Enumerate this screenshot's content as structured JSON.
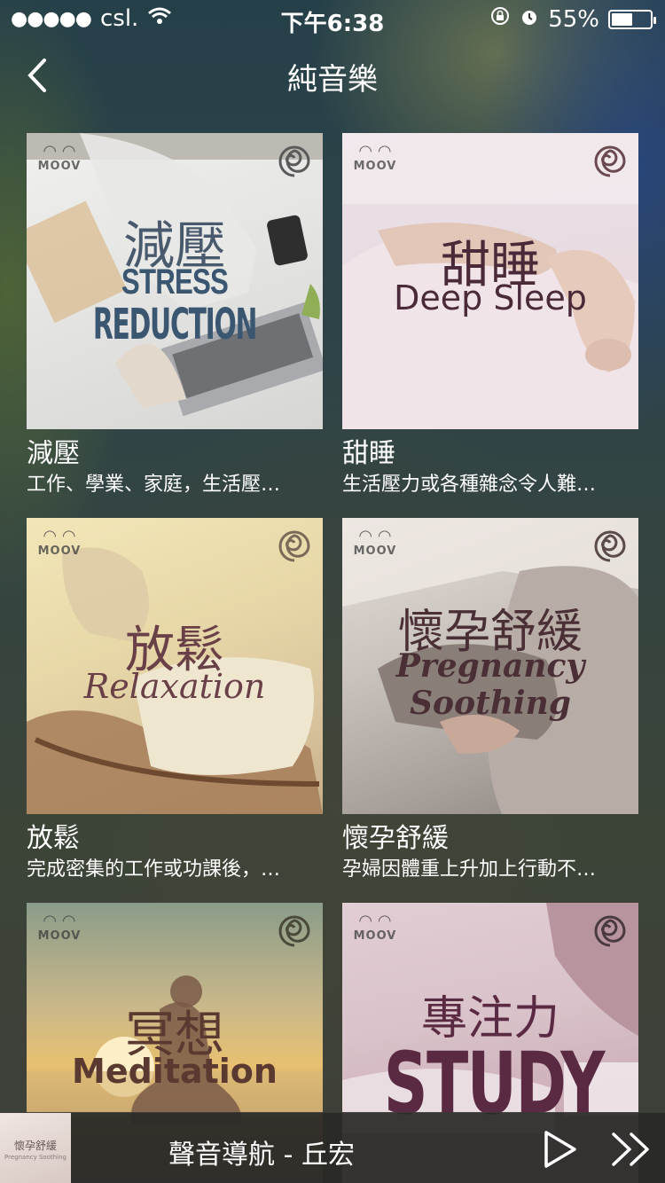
{
  "status_bar": {
    "signal_dots": "●●●●●",
    "carrier": "csl.",
    "time": "下午6:38",
    "battery_percent": "55%",
    "battery_level": 0.55,
    "icons": [
      "wifi-icon",
      "rotation-lock-icon",
      "alarm-icon",
      "battery-icon"
    ]
  },
  "nav": {
    "back_icon": "chevron-left-icon",
    "title": "純音樂"
  },
  "cards": [
    {
      "cover_brand": "MOOV",
      "cover_zh": "減壓",
      "cover_en_line1": "STRESS",
      "cover_en_line2": "REDUCTION",
      "title": "減壓",
      "desc": "工作、學業、家庭，生活壓…"
    },
    {
      "cover_brand": "MOOV",
      "cover_zh": "甜睡",
      "cover_en_line1": "Deep Sleep",
      "title": "甜睡",
      "desc": "生活壓力或各種雜念令人難…"
    },
    {
      "cover_brand": "MOOV",
      "cover_zh": "放鬆",
      "cover_en_line1": "Relaxation",
      "title": "放鬆",
      "desc": "完成密集的工作或功課後，…"
    },
    {
      "cover_brand": "MOOV",
      "cover_zh": "懷孕舒緩",
      "cover_en_line1": "Pregnancy",
      "cover_en_line2": "Soothing",
      "title": "懷孕舒緩",
      "desc": "孕婦因體重上升加上行動不…"
    },
    {
      "cover_brand": "MOOV",
      "cover_zh": "冥想",
      "cover_en_line1": "Meditation"
    },
    {
      "cover_brand": "MOOV",
      "cover_zh": "專注力",
      "cover_en_line1": "STUDY"
    }
  ],
  "player": {
    "thumb_text": "懷孕舒緩",
    "thumb_sub": "Pregnancy Soothing",
    "now_playing": "聲音導航 - 丘宏",
    "play_icon": "play-icon",
    "next_icon": "fast-forward-icon"
  },
  "colors": {
    "cover_text_dark": "#4a2a38",
    "cover_text_blue": "#3a5670",
    "study_text": "#5a2a42"
  }
}
